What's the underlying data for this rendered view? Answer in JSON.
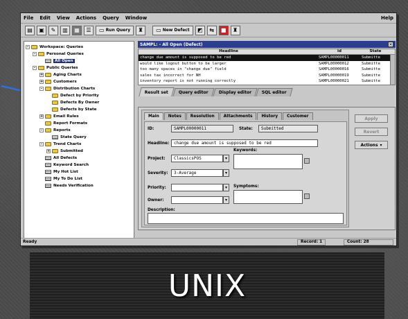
{
  "menubar": {
    "items": [
      "File",
      "Edit",
      "View",
      "Actions",
      "Query",
      "Window"
    ],
    "help": "Help"
  },
  "toolbar": {
    "run_query": "Run Query",
    "new_defect": "New Defect"
  },
  "tree": {
    "items": [
      {
        "label": "Workspace: Queries",
        "kind": "folder",
        "indent": 0,
        "exp": "-"
      },
      {
        "label": "Personal Queries",
        "kind": "folder",
        "indent": 1,
        "exp": "-"
      },
      {
        "label": "All Open",
        "kind": "query",
        "indent": 2,
        "selected": true
      },
      {
        "label": "Public Queries",
        "kind": "folder",
        "indent": 1,
        "exp": "-"
      },
      {
        "label": "Aging Charts",
        "kind": "folder",
        "indent": 2,
        "exp": "+"
      },
      {
        "label": "Customers",
        "kind": "folder",
        "indent": 2,
        "exp": "+"
      },
      {
        "label": "Distribution Charts",
        "kind": "folder",
        "indent": 2,
        "exp": "-"
      },
      {
        "label": "Defect by Priority",
        "kind": "folder",
        "indent": 3
      },
      {
        "label": "Defects By Owner",
        "kind": "folder",
        "indent": 3
      },
      {
        "label": "Defects by State",
        "kind": "folder",
        "indent": 3
      },
      {
        "label": "Email Rules",
        "kind": "folder",
        "indent": 2,
        "exp": "+"
      },
      {
        "label": "Report Formats",
        "kind": "folder",
        "indent": 2
      },
      {
        "label": "Reports",
        "kind": "folder",
        "indent": 2,
        "exp": "-"
      },
      {
        "label": "State Query",
        "kind": "query",
        "indent": 3
      },
      {
        "label": "Trend Charts",
        "kind": "folder",
        "indent": 2,
        "exp": "-"
      },
      {
        "label": "Submitted",
        "kind": "folder",
        "indent": 3,
        "exp": "+"
      },
      {
        "label": "All Defects",
        "kind": "query",
        "indent": 2
      },
      {
        "label": "Keyword Search",
        "kind": "query",
        "indent": 2
      },
      {
        "label": "My Hot List",
        "kind": "query",
        "indent": 2
      },
      {
        "label": "My To Do List",
        "kind": "query",
        "indent": 2
      },
      {
        "label": "Needs Verification",
        "kind": "query",
        "indent": 2
      }
    ]
  },
  "results": {
    "title": "SAMPL: - All Open (Defect)",
    "columns": {
      "headline": "Headline",
      "id": "id",
      "state": "State"
    },
    "rows": [
      {
        "headline": "change due amount is supposed to be red",
        "id": "SAMPL00000011",
        "state": "Submitte",
        "selected": true
      },
      {
        "headline": "would like logout button to be larger",
        "id": "SAMPL00000012",
        "state": "Submitte"
      },
      {
        "headline": "too many spaces in \"change due\" field",
        "id": "SAMPL00000016",
        "state": "Submitte"
      },
      {
        "headline": "sales tax incorrect for NH",
        "id": "SAMPL00000019",
        "state": "Submitte"
      },
      {
        "headline": "inventory report is not running correctly",
        "id": "SAMPL00000021",
        "state": "Submitte"
      }
    ],
    "tabs": [
      "Result set",
      "Query editor",
      "Display editor",
      "SQL editor"
    ]
  },
  "record": {
    "subtabs": [
      "Main",
      "Notes",
      "Resolution",
      "Attachments",
      "History",
      "Customer"
    ],
    "id_label": "ID:",
    "id_value": "SAMPL00000011",
    "state_label": "State:",
    "state_value": "Submitted",
    "headline_label": "Headline:",
    "headline_value": "change due amount is supposed to be red",
    "keywords_label": "Keywords:",
    "project_label": "Project:",
    "project_value": "ClassicsPOS",
    "severity_label": "Severity:",
    "severity_value": "3-Average",
    "priority_label": "Priority:",
    "priority_value": "",
    "owner_label": "Owner:",
    "owner_value": "",
    "symptoms_label": "Symptoms:",
    "description_label": "Description:",
    "buttons": {
      "apply": "Apply",
      "revert": "Revert",
      "actions": "Actions"
    }
  },
  "status": {
    "ready": "Ready",
    "record": "Record: 1",
    "count": "Count: 28"
  },
  "caption": "UNIX",
  "colors": {
    "title_bar": "#2a3d90",
    "arrow": "#2f6fe0",
    "folder": "#e8c84a"
  }
}
